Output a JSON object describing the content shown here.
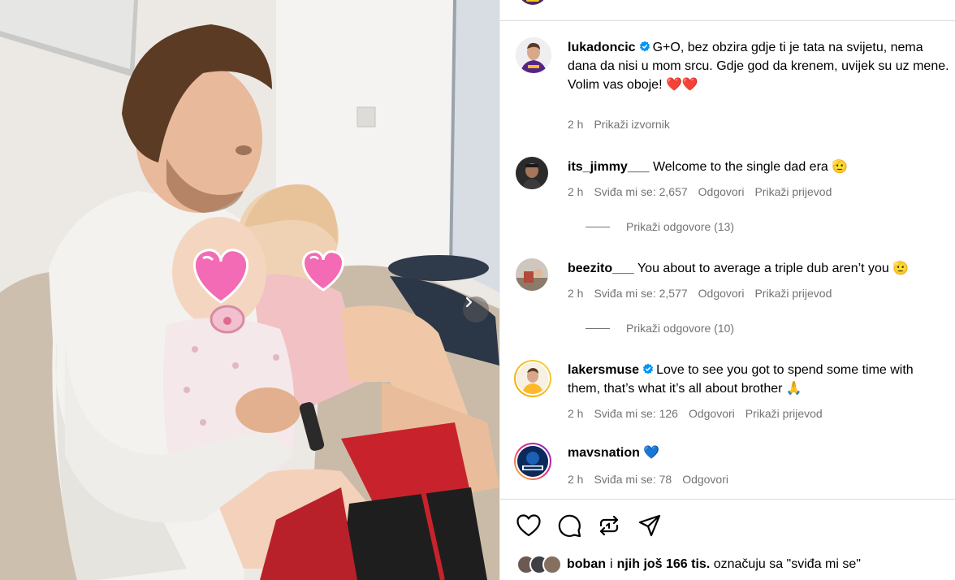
{
  "photo": {
    "alt_icon": "chevron-right-icon"
  },
  "comments": [
    {
      "username": "lukadoncic",
      "verified": true,
      "text": "G+O, bez obzira gdje ti je tata na svijetu, nema dana da nisi u mom srcu. Gdje god da krenem, uvijek su uz mene.",
      "text2": "Volim vas oboje! ❤️❤️",
      "time": "2 h",
      "action1": "Prikaži izvornik"
    },
    {
      "username": "its_jimmy___",
      "text": "Welcome to the single dad era 🫡",
      "time": "2 h",
      "likes": "Sviđa mi se: 2,657",
      "reply": "Odgovori",
      "translate": "Prikaži prijevod",
      "view_replies": "Prikaži odgovore (13)"
    },
    {
      "username": "beezito___",
      "text": "You about to average a triple dub aren’t you 🫡",
      "time": "2 h",
      "likes": "Sviđa mi se: 2,577",
      "reply": "Odgovori",
      "translate": "Prikaži prijevod",
      "view_replies": "Prikaži odgovore (10)"
    },
    {
      "username": "lakersmuse",
      "verified": true,
      "text": "Love to see you got to spend some time with them, that’s what it’s all about brother 🙏",
      "time": "2 h",
      "likes": "Sviđa mi se: 126",
      "reply": "Odgovori",
      "translate": "Prikaži prijevod"
    },
    {
      "username": "mavsnation",
      "text": "💙",
      "time": "2 h",
      "likes": "Sviđa mi se: 78",
      "reply": "Odgovori"
    }
  ],
  "likes_line": {
    "user": "boban",
    "middle": "i",
    "others": "njih još 166 tis.",
    "suffix": "označuju sa \"sviđa mi se\""
  },
  "colors": {
    "accent_verified": "#0095f6",
    "meta_gray": "#737373",
    "heart_red": "#e0245e"
  },
  "icons": [
    "verified-badge-icon",
    "heart-icon",
    "comment-icon",
    "repost-icon",
    "share-icon",
    "chevron-right-icon"
  ]
}
